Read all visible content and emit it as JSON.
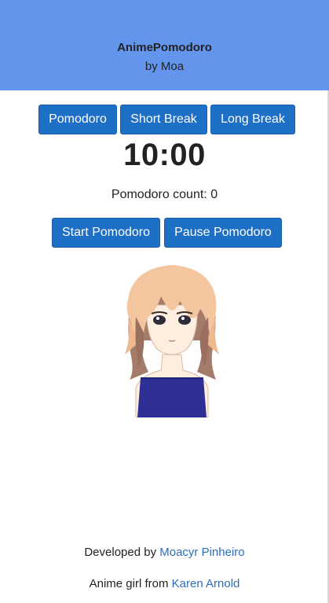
{
  "header": {
    "title": "AnimePomodoro",
    "author": "by Moa",
    "background_color": "#6495ed"
  },
  "modes": {
    "pomodoro_label": "Pomodoro",
    "short_break_label": "Short Break",
    "long_break_label": "Long Break"
  },
  "timer": {
    "display": "10:00"
  },
  "counter": {
    "label": "Pomodoro count: 0"
  },
  "controls": {
    "start_label": "Start Pomodoro",
    "pause_label": "Pause Pomodoro"
  },
  "illustration": {
    "icon": "anime-girl-illustration"
  },
  "footer": {
    "developed_by_text": "Developed by ",
    "developer_link": "Moacyr Pinheiro",
    "anime_girl_text": "Anime girl from ",
    "artist_link": "Karen Arnold"
  },
  "colors": {
    "button": "#1e6fc6",
    "link": "#2a6fbe"
  }
}
